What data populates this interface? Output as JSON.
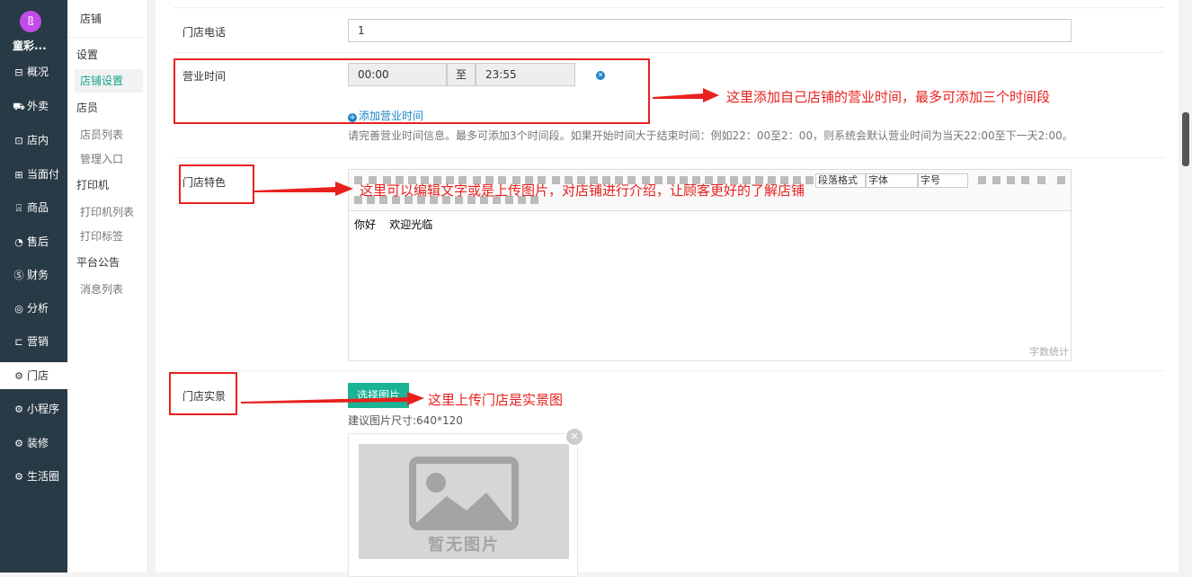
{
  "sidebar": {
    "shop_name": "童彩...",
    "logo_glyph": "ឱ",
    "items": [
      {
        "label": "概况",
        "icon": "dashboard-icon",
        "glyph": "⊟"
      },
      {
        "label": "外卖",
        "icon": "takeaway-icon",
        "glyph": "⛟"
      },
      {
        "label": "店内",
        "icon": "store-icon",
        "glyph": "⊡"
      },
      {
        "label": "当面付",
        "icon": "pay-icon",
        "glyph": "⊞"
      },
      {
        "label": "商品",
        "icon": "goods-icon",
        "glyph": "⍓"
      },
      {
        "label": "售后",
        "icon": "aftersale-icon",
        "glyph": "◔"
      },
      {
        "label": "财务",
        "icon": "finance-icon",
        "glyph": "Ⓢ"
      },
      {
        "label": "分析",
        "icon": "analysis-icon",
        "glyph": "◎"
      },
      {
        "label": "营销",
        "icon": "marketing-icon",
        "glyph": "⊏"
      },
      {
        "label": "门店",
        "icon": "gear-icon",
        "glyph": "⚙"
      },
      {
        "label": "小程序",
        "icon": "gear-icon",
        "glyph": "⚙"
      },
      {
        "label": "装修",
        "icon": "gear-icon",
        "glyph": "⚙"
      },
      {
        "label": "生活圈",
        "icon": "gear-icon",
        "glyph": "⚙"
      }
    ],
    "active_index": 9
  },
  "subnav": {
    "title": "店铺",
    "group_settings": "设置",
    "link_store_settings": "店铺设置",
    "group_staff": "店员",
    "link_staff_list": "店员列表",
    "link_admin_entry": "管理入口",
    "group_printer": "打印机",
    "link_printer_list": "打印机列表",
    "link_print_label": "打印标签",
    "group_notice": "平台公告",
    "link_message_list": "消息列表"
  },
  "form": {
    "phone_label": "门店电话",
    "phone_value": "1",
    "hours_label": "营业时间",
    "hours_start": "00:00",
    "hours_to": "至",
    "hours_end": "23:55",
    "add_hours": "添加营业时间",
    "hours_help": "请完善营业时间信息。最多可添加3个时间段。如果开始时间大于结束时间：例如22：00至2：00，则系统会默认营业时间为当天22:00至下一天2:00。",
    "feature_label": "门店特色",
    "editor_content": "你好    欢迎光临",
    "editor_format": "段落格式",
    "editor_font": "字体",
    "editor_size": "字号",
    "word_count": "字数统计",
    "photo_label": "门店实景",
    "choose_image": "选择图片",
    "image_hint": "建议图片尺寸:640*120",
    "no_image": "暂无图片"
  },
  "annotations": {
    "note_hours": "这里添加自己店铺的营业时间，最多可添加三个时间段",
    "note_feature": "这里可以编辑文字或是上传图片，对店铺进行介绍，让顾客更好的了解店铺",
    "note_photo": "这里上传门店是实景图"
  },
  "colors": {
    "nav_bg": "#283a45",
    "accent_green": "#1ab394",
    "link_blue": "#1c84c6",
    "annotation_red": "#e8211e"
  }
}
